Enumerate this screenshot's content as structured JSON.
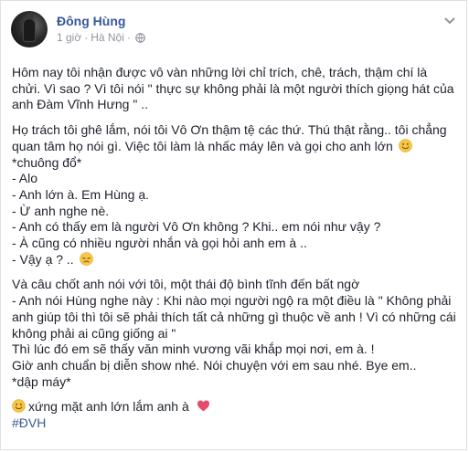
{
  "post": {
    "author": "Đông Hùng",
    "time": "1 giờ",
    "separator": "·",
    "location": "Hà Nội",
    "icons": {
      "avatar": "profile-photo",
      "privacy": "globe-icon",
      "menu": "chevron-down-icon",
      "smile": "smile-emoji-icon",
      "sad": "disappointed-emoji-icon",
      "heart": "heart-emoji-icon"
    },
    "colors": {
      "author": "#365899",
      "meta": "#90949c",
      "text": "#1d2129"
    },
    "paragraph1": [
      "Hôm nay tôi nhận được vô vàn những lời chỉ trích, chê, trách, thậm chí là",
      "chửi. Vì sao ? Vì tôi nói \" thực sự không phải là một người thích giọng hát của",
      "anh Đàm Vĩnh Hưng \" .."
    ],
    "paragraph2": {
      "line1": "Họ trách tôi ghê lắm, nói tôi Vô Ơn thậm tệ các thứ. Thú thật rằng.. tôi chẳng",
      "line2": "quan tâm họ nói gì. Việc tôi làm là nhấc máy lên và gọi cho anh lớn",
      "line3": "*chuông đổ*",
      "line4": "- Alo",
      "line5": "- Anh lớn à. Em Hùng ạ.",
      "line6": "- Ừ anh nghe nè.",
      "line7": "- Anh có thấy em là người Vô Ơn không ? Khi.. em nói như vậy ?",
      "line8": "- À cũng có nhiều người nhắn và gọi hỏi anh em à ..",
      "line9": "- Vậy ạ ? .."
    },
    "paragraph3": [
      "Và câu chốt anh nói với tôi, một thái độ bình tĩnh đến bất ngờ",
      "- Anh nói Hùng nghe này : Khi nào mọi người ngộ ra một điều là \" Không phải",
      "anh giúp tôi thì tôi sẽ phải thích tất cả những gì thuộc về anh ! Vì có những cái",
      "không phải ai cũng giống ai \"",
      "Thì lúc đó em sẽ thấy văn minh vương vãi khắp mọi nơi, em à. !",
      "Giờ anh chuẩn bị diễn show nhé. Nói chuyện với em sau nhé. Bye em..",
      "*dập máy*"
    ],
    "closing": "xứng mặt anh lớn lắm anh à",
    "hashtag": "#ĐVH"
  }
}
